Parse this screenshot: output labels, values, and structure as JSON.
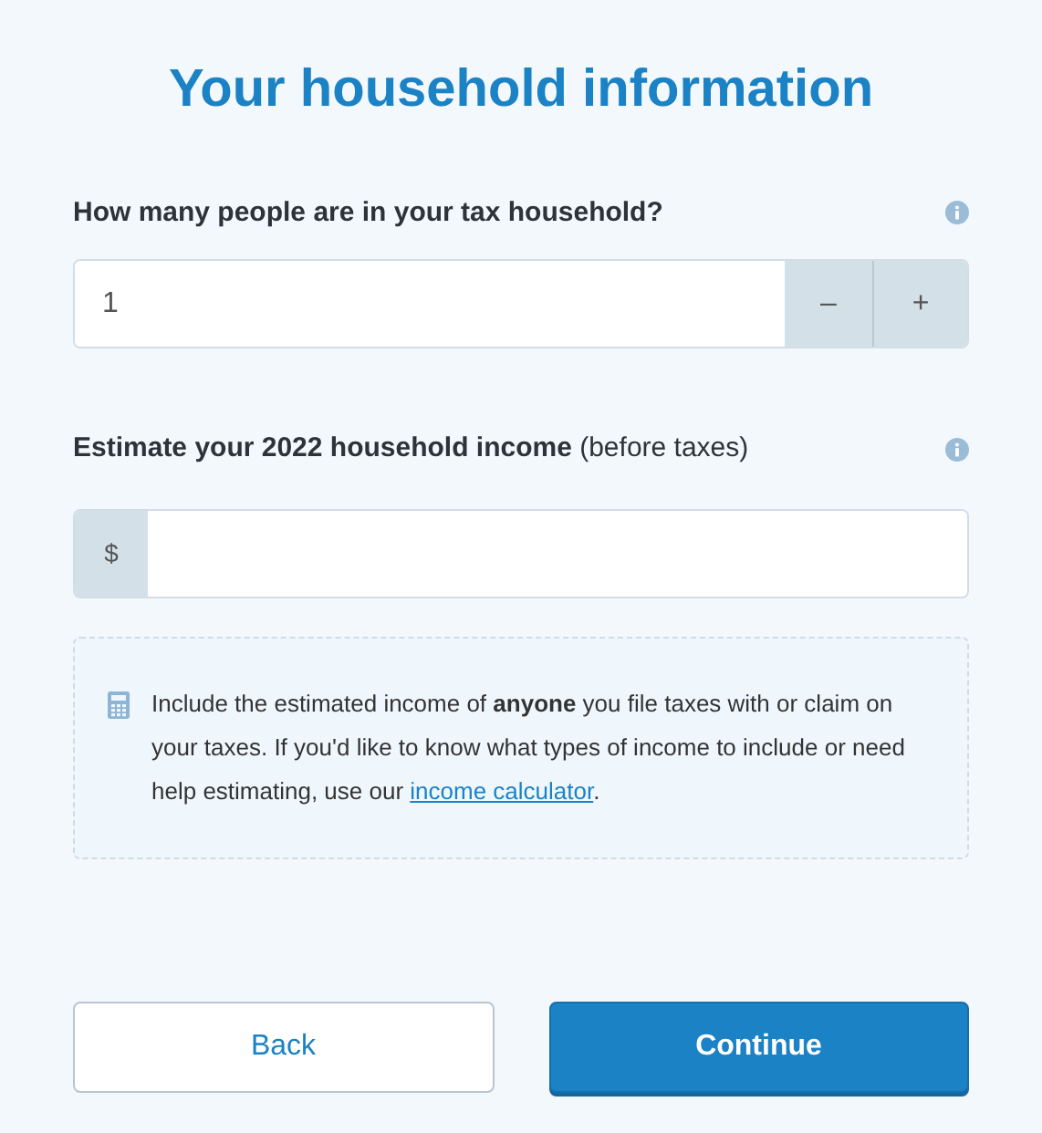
{
  "title": "Your household information",
  "household_size": {
    "label": "How many people are in your tax household?",
    "value": "1",
    "decrement": "–",
    "increment": "+"
  },
  "income": {
    "label": "Estimate your 2022 household income",
    "label_note": "(before taxes)",
    "prefix": "$"
  },
  "note": {
    "text": "Include the estimated income of **anyone** you file taxes with or claim on your taxes. If you'd like to know what types of income to include or need help estimating, use our",
    "link": "income calculator",
    "text_after": "."
  },
  "buttons": [
    {
      "label": "Back",
      "kind": "secondary"
    },
    {
      "label": "Continue",
      "kind": "primary"
    }
  ]
}
